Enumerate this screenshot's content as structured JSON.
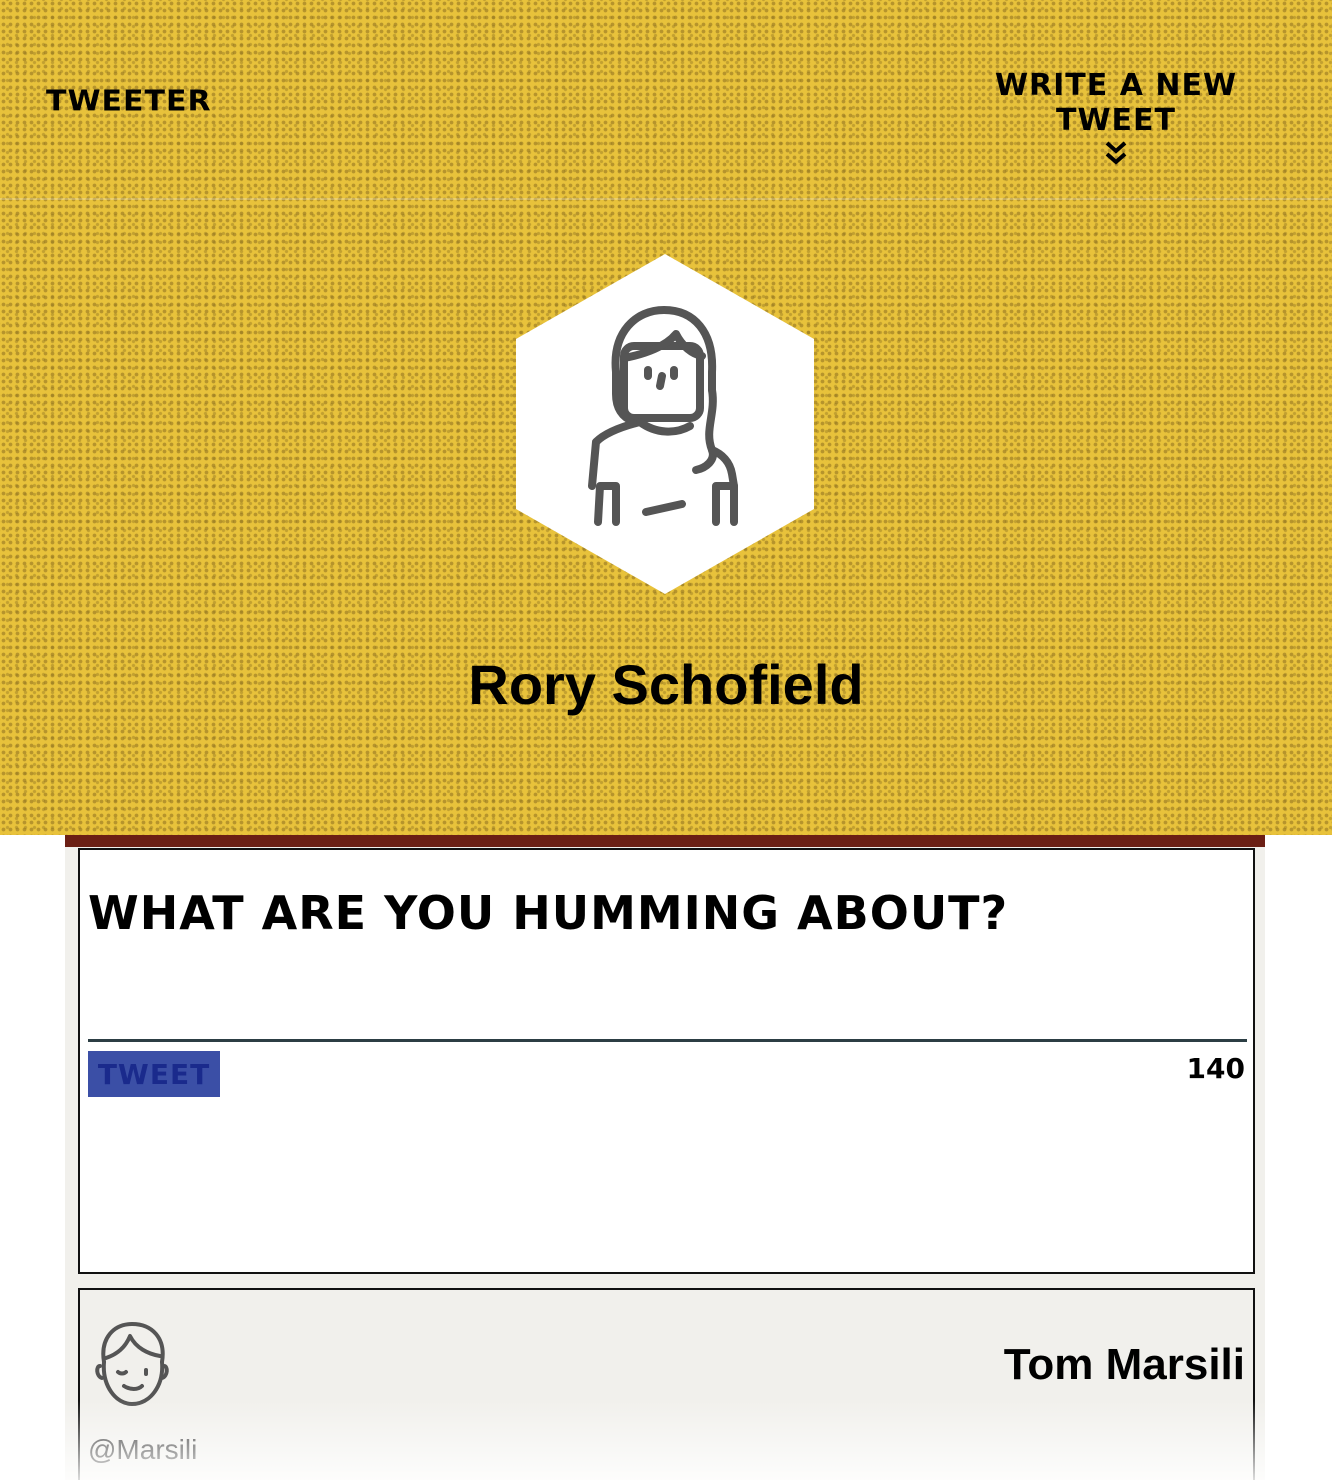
{
  "nav": {
    "logo": "Tweeter",
    "write_link": "Write a new tweet",
    "write_icon": "double-chevron-down-icon"
  },
  "profile": {
    "name": "Rory Schofield",
    "avatar_icon": "woman-avatar-icon"
  },
  "compose": {
    "heading": "What are you humming about?",
    "input_value": "",
    "button_label": "Tweet",
    "char_count": "140"
  },
  "tweets": [
    {
      "author": "Tom Marsili",
      "handle": "@Marsili",
      "avatar_icon": "man-avatar-icon"
    }
  ],
  "colors": {
    "header_background": "#e8c23b",
    "tweet_button": "#3b4fa6",
    "card_background": "#f1f0ec"
  }
}
